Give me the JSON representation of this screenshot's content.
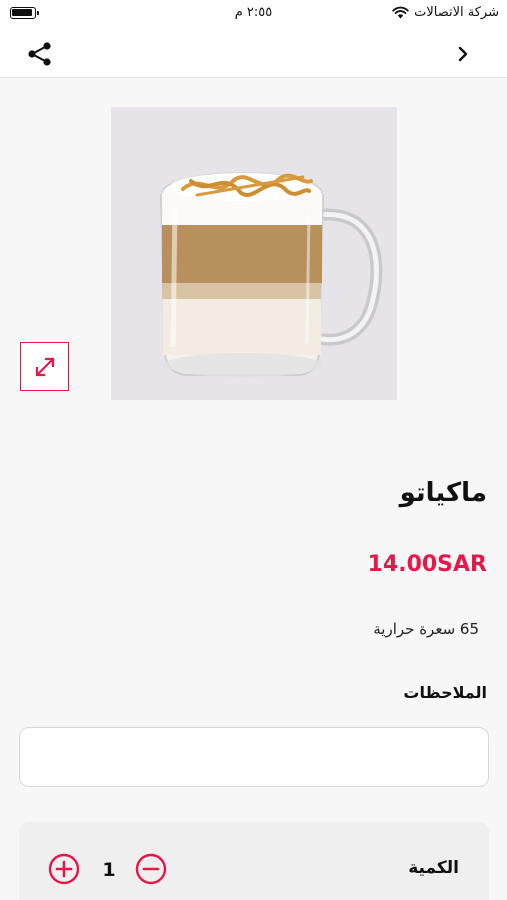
{
  "status_bar": {
    "carrier": "شركة الاتصالات",
    "time": "٢:٥٥ م"
  },
  "nav": {
    "share_icon": "share-icon",
    "back_icon": "chevron-right-icon"
  },
  "product": {
    "title": "ماكياتو",
    "price": "14.00SAR",
    "calories": "65 سعرة حرارية",
    "image": "caramel macchiato glass mug"
  },
  "notes": {
    "label": "الملاحظات",
    "value": "",
    "placeholder": ""
  },
  "quantity": {
    "label": "الكمية",
    "value": "1"
  },
  "colors": {
    "accent": "#e8174a",
    "background": "#f7f7f7"
  }
}
